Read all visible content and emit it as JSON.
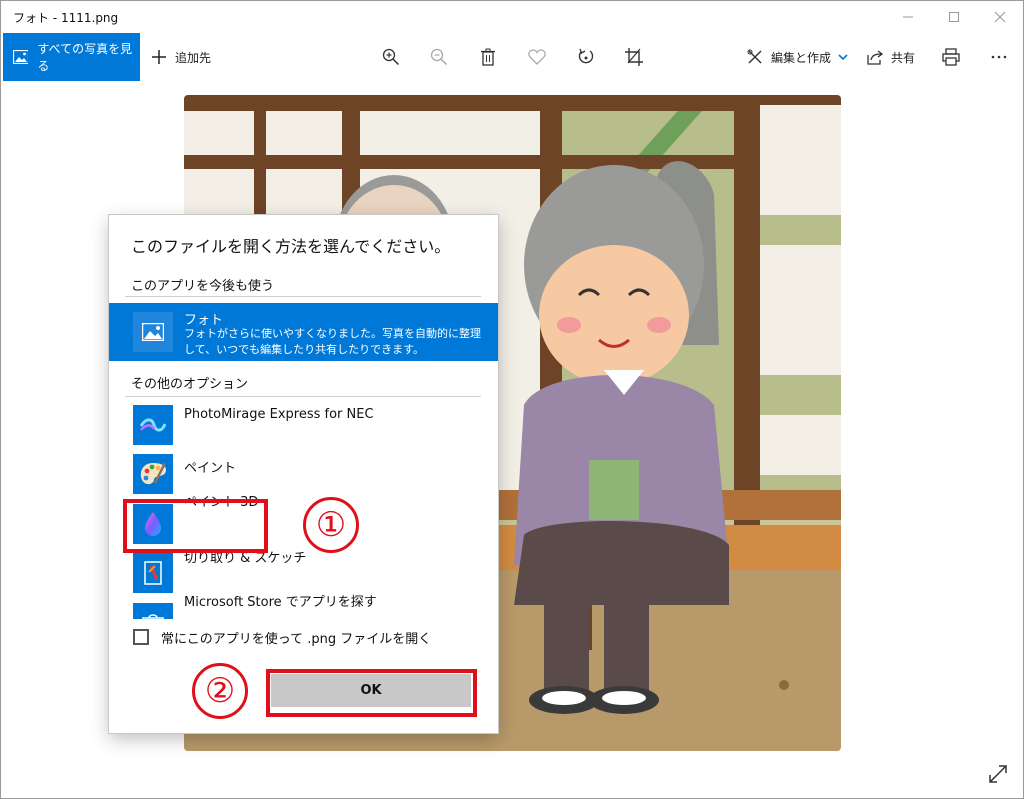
{
  "window": {
    "title": "フォト - 1111.png"
  },
  "toolbar": {
    "all_photos_label": "すべての写真を見る",
    "add_to_label": "追加先",
    "edit_create_label": "編集と作成",
    "share_label": "共有",
    "accent": "#0078d7"
  },
  "dialog": {
    "title": "このファイルを開く方法を選んでください。",
    "keep_using_header": "このアプリを今後も使う",
    "selected_app": {
      "name": "フォト",
      "description": "フォトがさらに使いやすくなりました。写真を自動的に整理して、いつでも編集したり共有したりできます。"
    },
    "other_options_header": "その他のオプション",
    "apps": [
      {
        "name": "PhotoMirage Express for NEC",
        "icon": "photomirage-icon"
      },
      {
        "name": "ペイント",
        "icon": "paint-palette-icon"
      },
      {
        "name": "ペイント 3D",
        "icon": "paint3d-drop-icon"
      },
      {
        "name": "切り取り & スケッチ",
        "icon": "snip-sketch-icon"
      },
      {
        "name": "Microsoft Store でアプリを探す",
        "icon": "store-icon"
      }
    ],
    "always_use_label": "常にこのアプリを使って .png ファイルを開く",
    "always_use_checked": false,
    "ok_label": "OK"
  },
  "annotations": {
    "step1": "①",
    "step2": "②",
    "color": "#e0101a"
  }
}
